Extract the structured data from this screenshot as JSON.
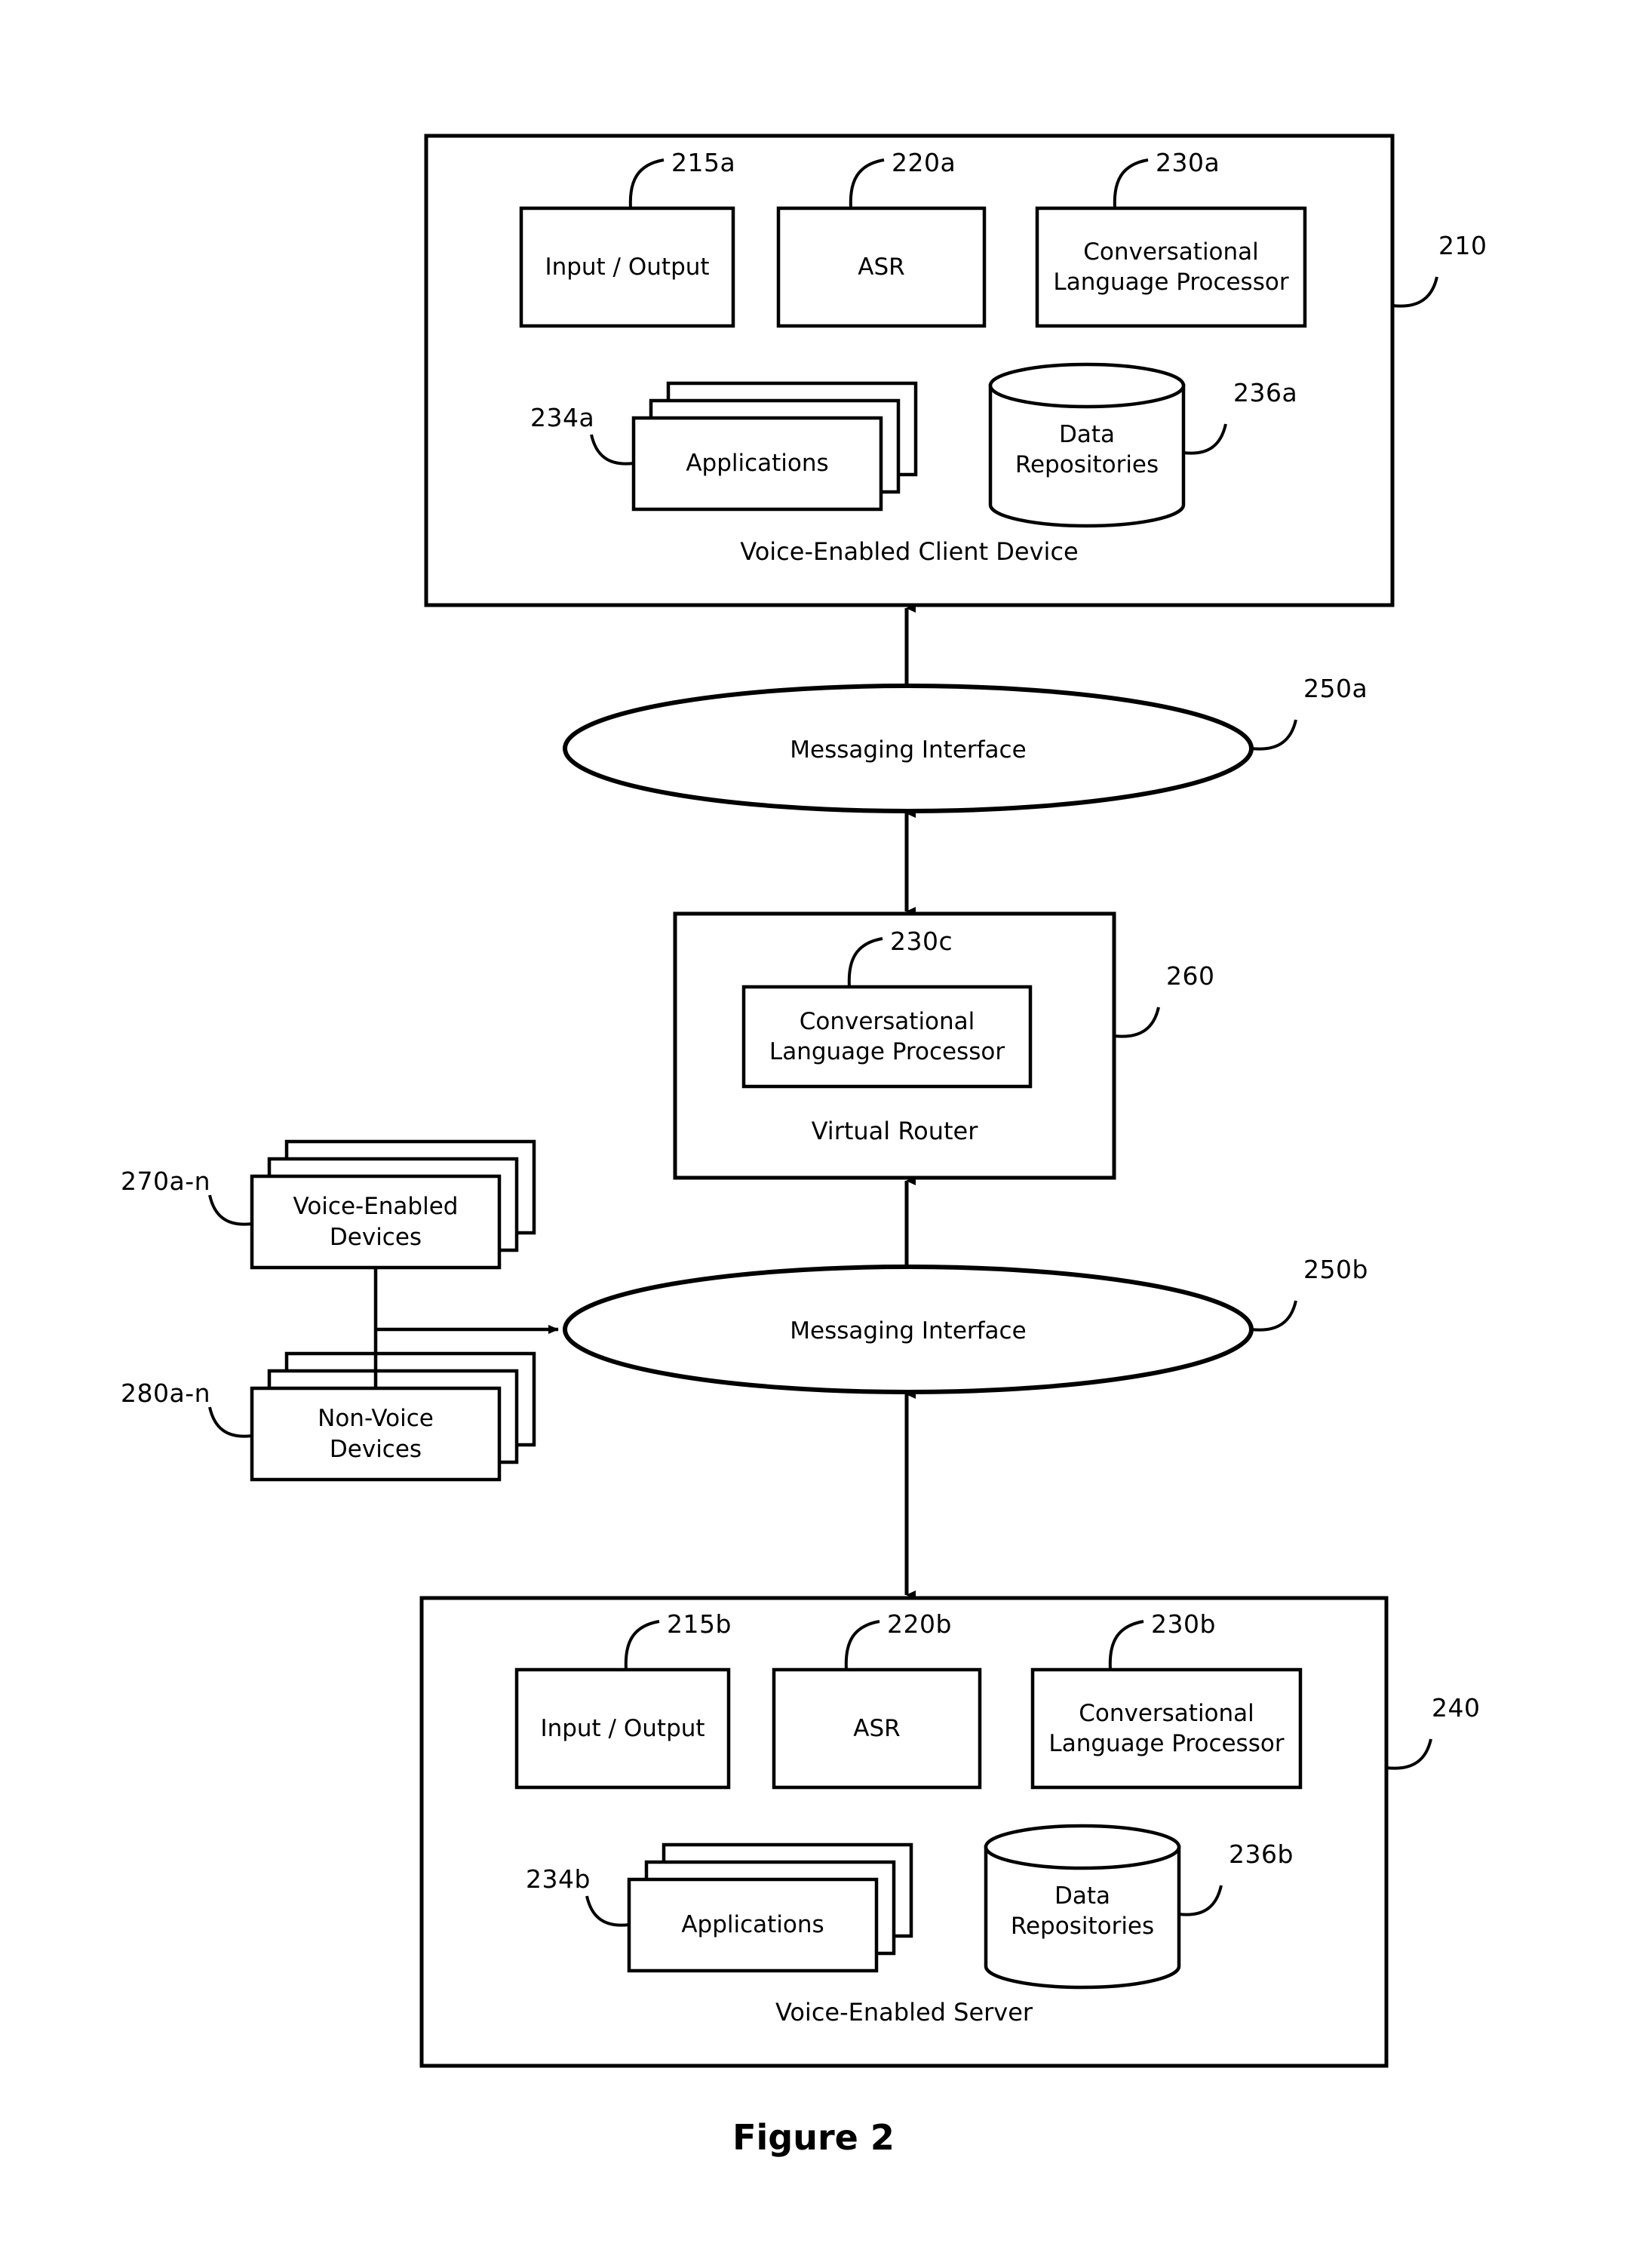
{
  "figure": {
    "caption": "Figure 2"
  },
  "client_device": {
    "ref": "210",
    "caption": "Voice-Enabled Client Device",
    "components": [
      {
        "ref": "215a",
        "label": "Input / Output"
      },
      {
        "ref": "220a",
        "label": "ASR"
      },
      {
        "ref": "230a",
        "label": "Conversational\nLanguage Processor"
      },
      {
        "ref": "234a",
        "label": "Applications"
      },
      {
        "ref": "236a",
        "label": "Data\nRepositories"
      }
    ]
  },
  "messaging_interface_top": {
    "ref": "250a",
    "label": "Messaging Interface"
  },
  "virtual_router": {
    "ref": "260",
    "caption": "Virtual Router",
    "components": [
      {
        "ref": "230c",
        "label": "Conversational\nLanguage Processor"
      }
    ]
  },
  "voice_enabled_devices": {
    "ref": "270a-n",
    "label": "Voice-Enabled\nDevices"
  },
  "non_voice_devices": {
    "ref": "280a-n",
    "label": "Non-Voice\nDevices"
  },
  "messaging_interface_bottom": {
    "ref": "250b",
    "label": "Messaging Interface"
  },
  "server": {
    "ref": "240",
    "caption": "Voice-Enabled Server",
    "components": [
      {
        "ref": "215b",
        "label": "Input / Output"
      },
      {
        "ref": "220b",
        "label": "ASR"
      },
      {
        "ref": "230b",
        "label": "Conversational\nLanguage Processor"
      },
      {
        "ref": "234b",
        "label": "Applications"
      },
      {
        "ref": "236b",
        "label": "Data\nRepositories"
      }
    ]
  },
  "colors": {
    "stroke": "#000000",
    "background": "#ffffff"
  }
}
